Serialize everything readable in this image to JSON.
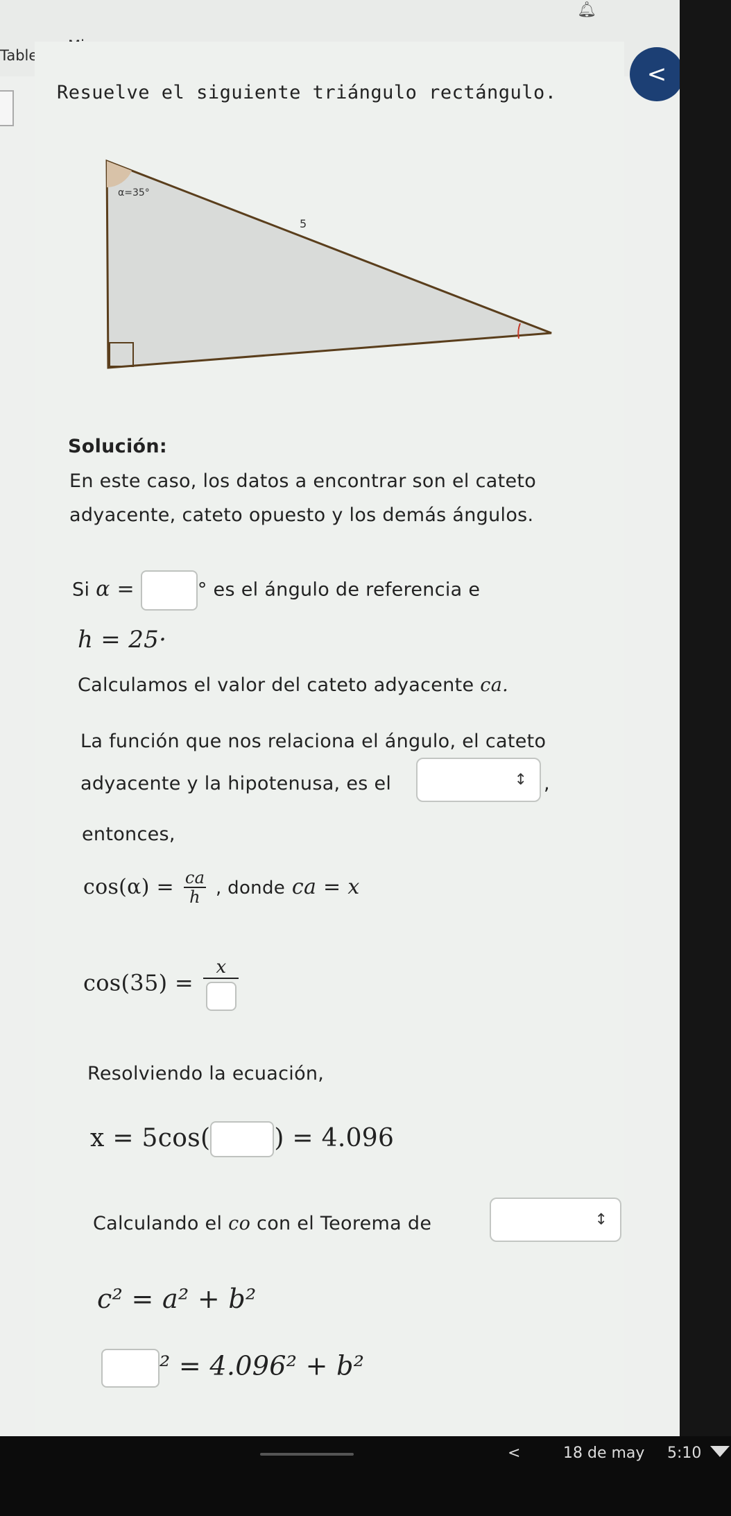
{
  "nav": {
    "tablero": "Tablero",
    "mis_cursos": "Mis cursos",
    "back": "<"
  },
  "question": {
    "title": "Resuelve el siguiente triángulo rectángulo.",
    "angle_label": "α=35°",
    "hyp_label": "5"
  },
  "solution": {
    "heading": "Solución:",
    "p1_line1": "En este caso, los datos a encontrar son el cateto",
    "p1_line2": "adyacente, cateto opuesto y los demás ángulos.",
    "si": "Si",
    "alpha_eq": "α =",
    "ref_text": "° es el ángulo de referencia e",
    "h_eq": "h = 25·",
    "calc_ca": "Calculamos el valor del cateto adyacente",
    "ca_sym": "ca.",
    "func_line1": "La función que nos relaciona el ángulo, el cateto",
    "func_line2": "adyacente y la hipotenusa, es el",
    "comma": ",",
    "entonces": "entonces,",
    "cos_alpha": "cos(α) =",
    "frac1_num": "ca",
    "frac1_den": "h",
    "donde": ", donde",
    "ca_eq_x": "ca = x",
    "cos35": "cos(35) =",
    "frac2_num": "x",
    "resolviendo": "Resolviendo la ecuación,",
    "x_eq": "x = 5cos(",
    "x_result": ") = 4.096",
    "calc_co": "Calculando el",
    "co_sym": "co",
    "teorema": "con el Teorema de",
    "pyth": "c² = a² + b²",
    "pyth2": "² = 4.096² + b²"
  },
  "taskbar": {
    "chevron": "<",
    "date": "18 de may",
    "time": "5:10"
  },
  "colors": {
    "accent": "#1c3f74",
    "triangle_fill": "#d9dbd9",
    "triangle_stroke": "#5a3e1c",
    "angle_marker": "#c83a2a"
  }
}
